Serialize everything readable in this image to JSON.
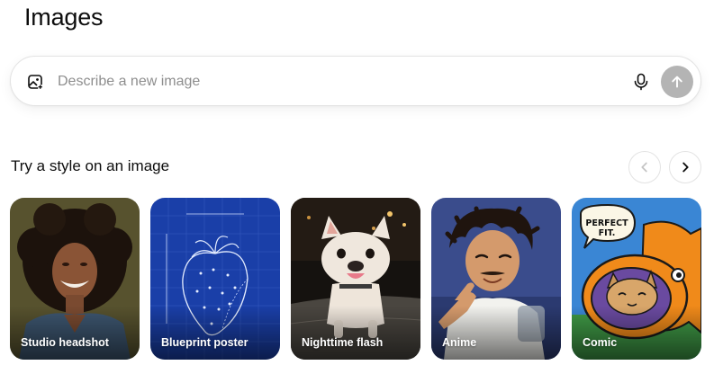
{
  "page": {
    "title": "Images"
  },
  "prompt": {
    "placeholder": "Describe a new image",
    "value": "",
    "upload_icon": "image-upload-icon",
    "mic_icon": "microphone-icon",
    "send_icon": "arrow-up-icon"
  },
  "styles_section": {
    "title": "Try a style on an image",
    "prev_icon": "chevron-left-icon",
    "next_icon": "chevron-right-icon",
    "cards": [
      {
        "label": "Studio headshot"
      },
      {
        "label": "Blueprint poster"
      },
      {
        "label": "Nighttime flash"
      },
      {
        "label": "Anime"
      },
      {
        "label": "Comic",
        "art_text": "PERFECT FIT."
      }
    ]
  },
  "colors": {
    "send_button_disabled": "#b4b4b4",
    "blueprint": "#1a3fa8",
    "comic_bg": "#3a86d4",
    "comic_fish": "#f08a1a"
  }
}
